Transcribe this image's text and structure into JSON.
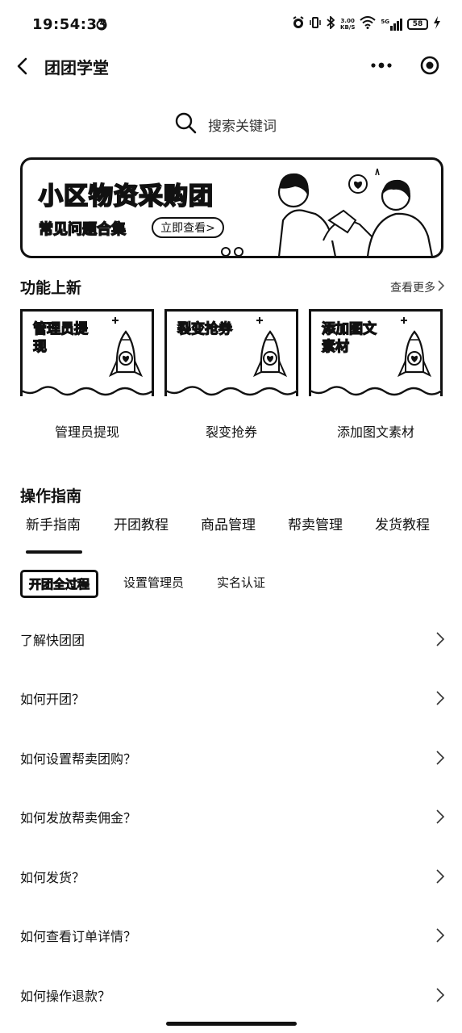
{
  "status_bar": {
    "time": "19:54:33",
    "net_speed_value": "3.00",
    "net_speed_unit": "KB/S",
    "network": "5G",
    "battery": "58"
  },
  "nav": {
    "title": "团团学堂"
  },
  "search": {
    "placeholder": "搜索关键词"
  },
  "banner": {
    "title": "小区物资采购团",
    "subtitle": "常见问题合集",
    "button": "立即查看>"
  },
  "features": {
    "title": "功能上新",
    "see_more": "查看更多",
    "items": [
      {
        "card_label": "管理员提现",
        "name": "管理员提现"
      },
      {
        "card_label": "裂变抢券",
        "name": "裂变抢券"
      },
      {
        "card_label": "添加图文素材",
        "name": "添加图文素材"
      }
    ]
  },
  "guide": {
    "title": "操作指南",
    "tabs": [
      "新手指南",
      "开团教程",
      "商品管理",
      "帮卖管理",
      "发货教程"
    ],
    "sub_tabs": [
      "开团全过程",
      "设置管理员",
      "实名认证"
    ],
    "faq": [
      "了解快团团",
      "如何开团？",
      "如何设置帮卖团购？",
      "如何发放帮卖佣金？",
      "如何发货？",
      "如何查看订单详情？",
      "如何操作退款？"
    ]
  }
}
